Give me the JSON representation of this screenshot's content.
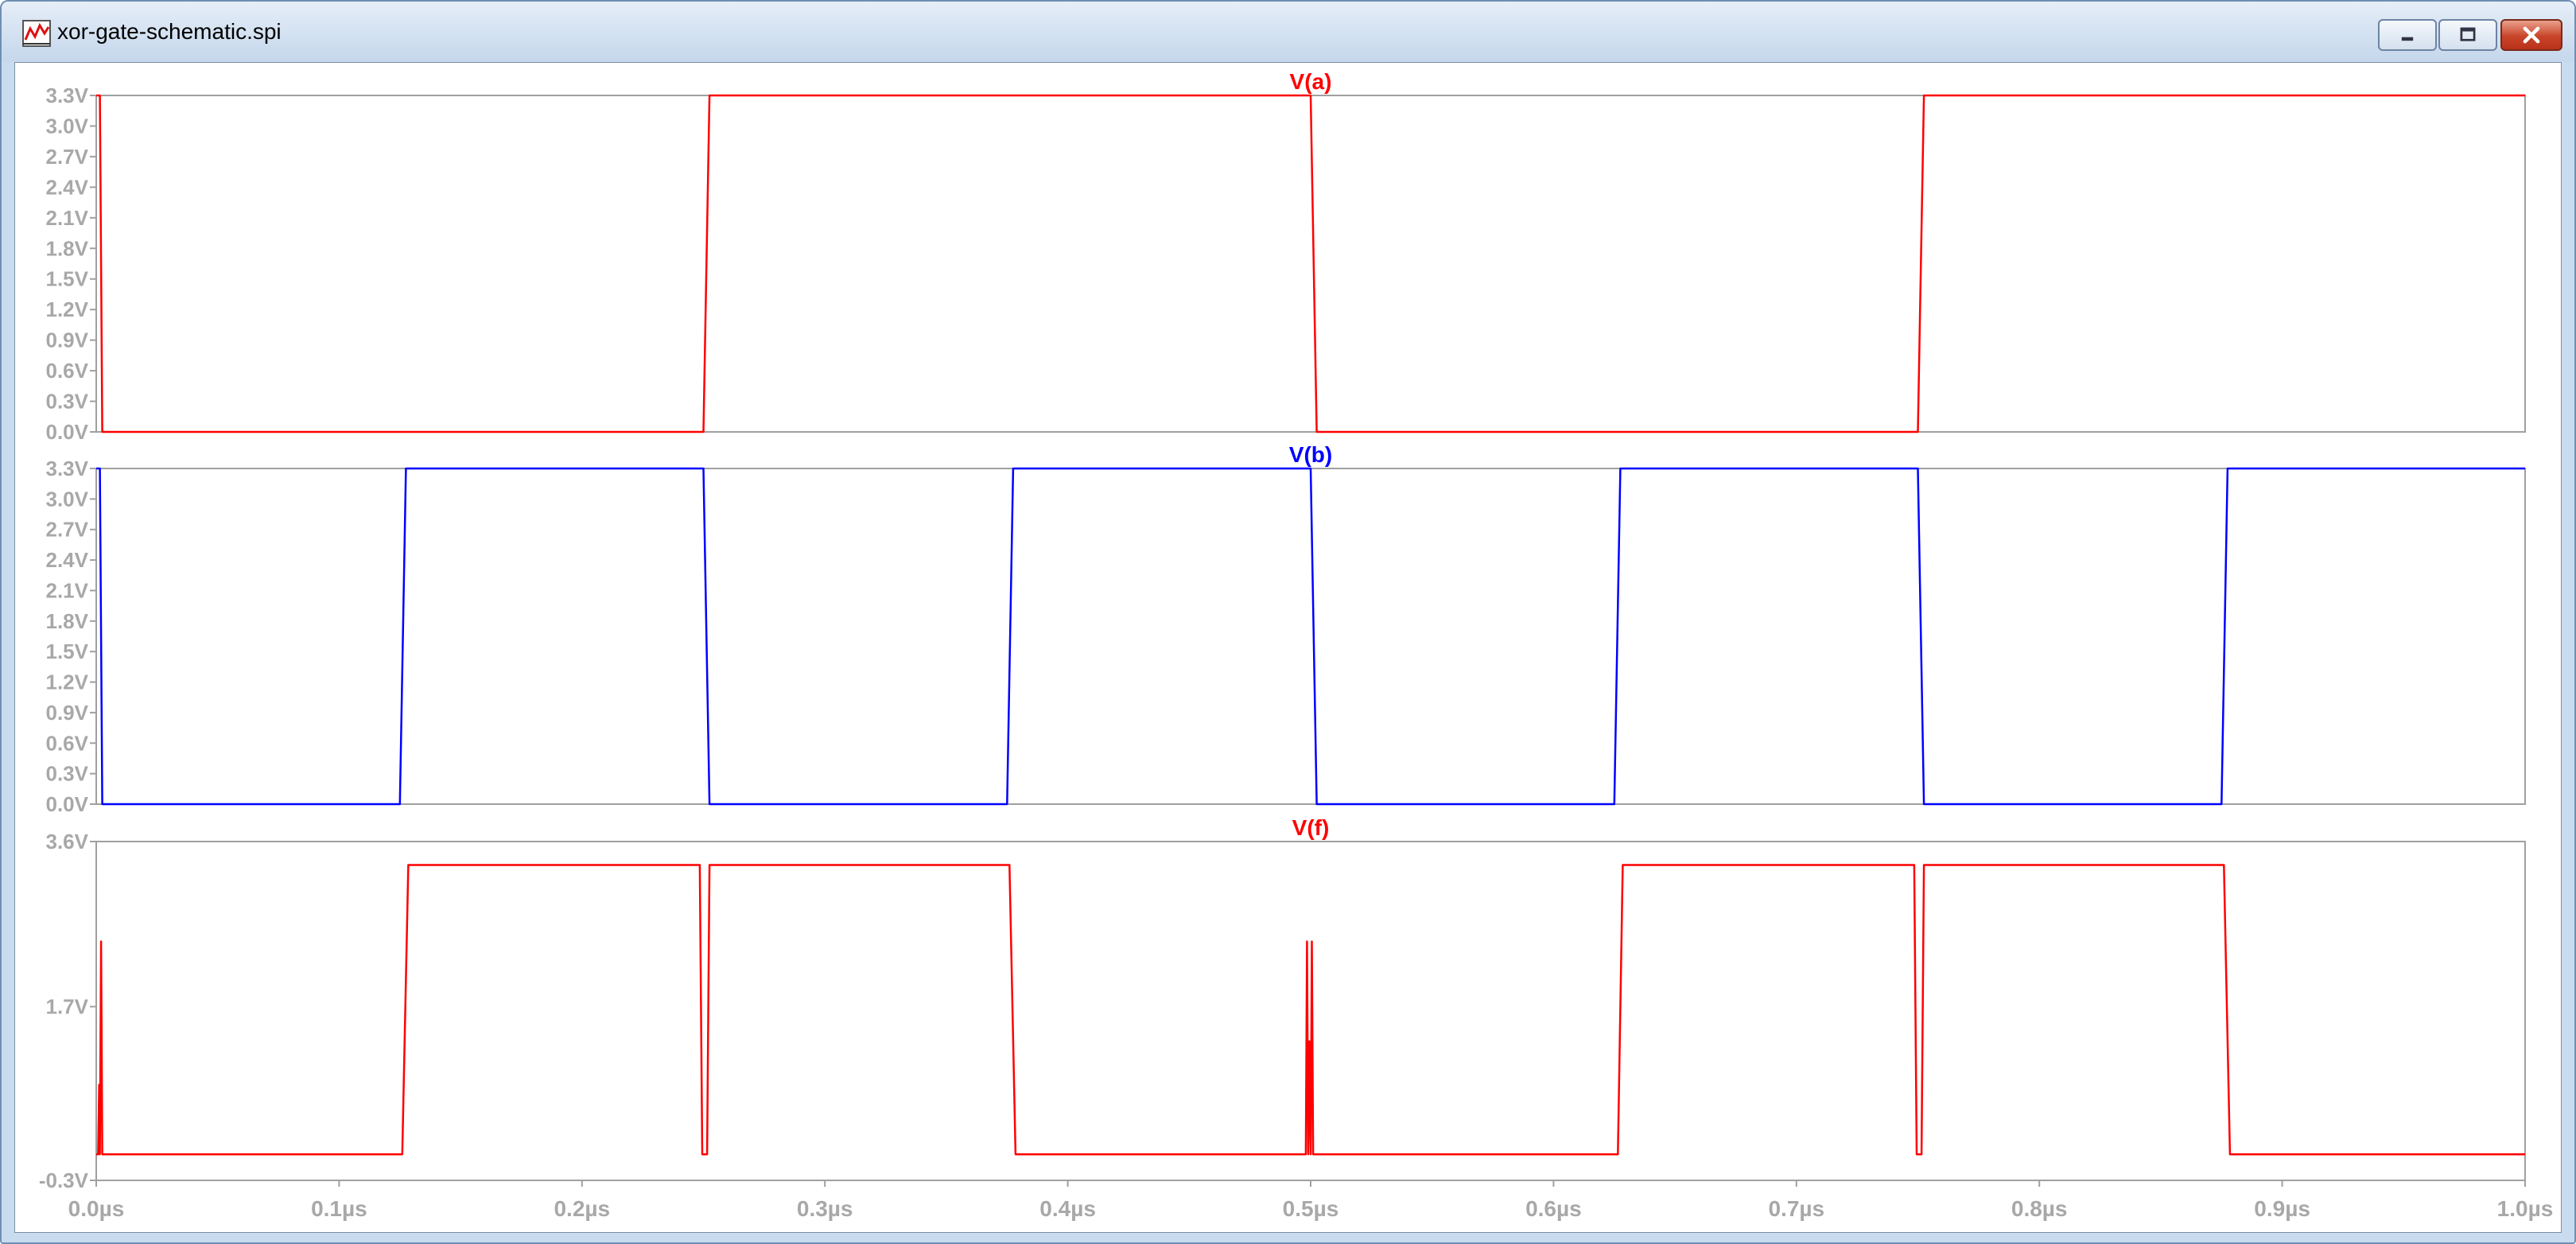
{
  "window": {
    "title": "xor-gate-schematic.spi",
    "icons": {
      "app": "waveform-icon",
      "minimize": "minimize-icon",
      "maximize": "maximize-icon",
      "close": "close-icon"
    },
    "colors": {
      "title_bar": "#d3e1f1",
      "close_button": "#c8452a",
      "frame": "#6f8fb3"
    }
  },
  "chart_data": [
    {
      "type": "line",
      "title": "V(a)",
      "title_color": "#ff0000",
      "series": [
        {
          "name": "V(a)",
          "color": "#ff0000",
          "x": [
            0,
            0.0015,
            0.0025,
            0.25,
            0.2525,
            0.5,
            0.5025,
            0.75,
            0.7525,
            1.0
          ],
          "y": [
            3.3,
            3.3,
            0,
            0,
            3.3,
            3.3,
            0,
            0,
            3.3,
            3.3
          ]
        }
      ],
      "ylim": [
        0,
        3.3
      ],
      "yticks": [
        0.0,
        0.3,
        0.6,
        0.9,
        1.2,
        1.5,
        1.8,
        2.1,
        2.4,
        2.7,
        3.0,
        3.3
      ],
      "ytick_labels": [
        "0.0V",
        "0.3V",
        "0.6V",
        "0.9V",
        "1.2V",
        "1.5V",
        "1.8V",
        "2.1V",
        "2.4V",
        "2.7V",
        "3.0V",
        "3.3V"
      ],
      "xlim": [
        0,
        1.0
      ],
      "grid": false
    },
    {
      "type": "line",
      "title": "V(b)",
      "title_color": "#0000ff",
      "series": [
        {
          "name": "V(b)",
          "color": "#0000ff",
          "x": [
            0,
            0.0015,
            0.0025,
            0.125,
            0.1275,
            0.25,
            0.2525,
            0.375,
            0.3775,
            0.5,
            0.5025,
            0.625,
            0.6275,
            0.75,
            0.7525,
            0.875,
            0.8775,
            1.0
          ],
          "y": [
            3.3,
            3.3,
            0,
            0,
            3.3,
            3.3,
            0,
            0,
            3.3,
            3.3,
            0,
            0,
            3.3,
            3.3,
            0,
            0,
            3.3,
            3.3
          ]
        }
      ],
      "ylim": [
        0,
        3.3
      ],
      "yticks": [
        0.0,
        0.3,
        0.6,
        0.9,
        1.2,
        1.5,
        1.8,
        2.1,
        2.4,
        2.7,
        3.0,
        3.3
      ],
      "ytick_labels": [
        "0.0V",
        "0.3V",
        "0.6V",
        "0.9V",
        "1.2V",
        "1.5V",
        "1.8V",
        "2.1V",
        "2.4V",
        "2.7V",
        "3.0V",
        "3.3V"
      ],
      "xlim": [
        0,
        1.0
      ],
      "grid": false
    },
    {
      "type": "line",
      "title": "V(f)",
      "title_color": "#ff0000",
      "series": [
        {
          "name": "V(f)",
          "color": "#ff0000",
          "x": [
            0,
            0.0008,
            0.0012,
            0.0015,
            0.002,
            0.0025,
            0.003,
            0.126,
            0.1285,
            0.2485,
            0.2495,
            0.2515,
            0.2525,
            0.376,
            0.3785,
            0.498,
            0.4985,
            0.499,
            0.4995,
            0.5,
            0.5005,
            0.501,
            0.5015,
            0.6265,
            0.6285,
            0.7485,
            0.7495,
            0.7515,
            0.7525,
            0.876,
            0.8785,
            1.0
          ],
          "y": [
            0.0,
            0.0,
            0.8,
            0.0,
            2.45,
            0.0,
            0.0,
            0.0,
            3.33,
            3.33,
            0.0,
            0.0,
            3.33,
            3.33,
            0.0,
            0.0,
            2.45,
            0.0,
            1.3,
            0.0,
            2.45,
            0.0,
            0.0,
            0.0,
            3.33,
            3.33,
            0.0,
            0.0,
            3.33,
            3.33,
            0.0,
            0.0
          ]
        }
      ],
      "ylim": [
        -0.3,
        3.6
      ],
      "yticks": [
        -0.3,
        1.7,
        3.6
      ],
      "ytick_labels": [
        "-0.3V",
        "1.7V",
        "3.6V"
      ],
      "xlim": [
        0,
        1.0
      ],
      "xticks": [
        0,
        0.1,
        0.2,
        0.3,
        0.4,
        0.5,
        0.6,
        0.7,
        0.8,
        0.9,
        1.0
      ],
      "xtick_labels": [
        "0.0µs",
        "0.1µs",
        "0.2µs",
        "0.3µs",
        "0.4µs",
        "0.5µs",
        "0.6µs",
        "0.7µs",
        "0.8µs",
        "0.9µs",
        "1.0µs"
      ],
      "grid": false
    }
  ]
}
